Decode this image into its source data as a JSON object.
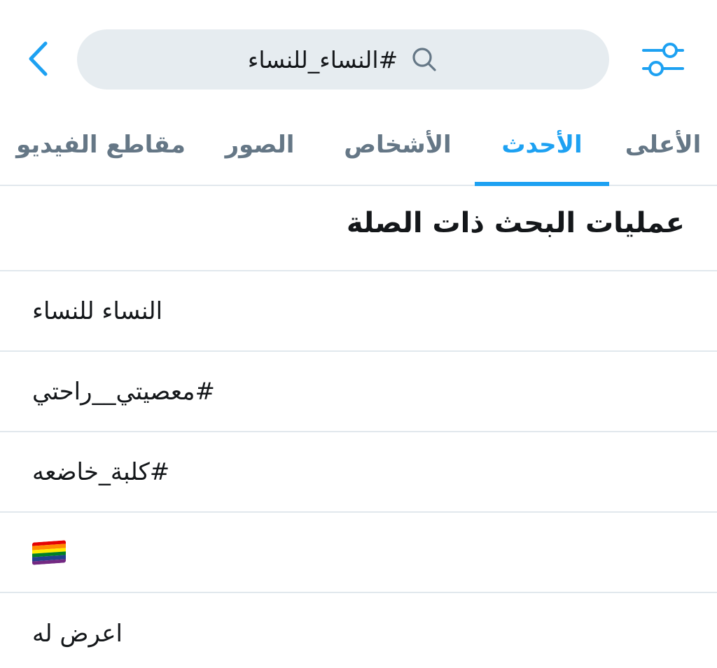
{
  "header": {
    "search_query": "#النساء_للنساء",
    "back_icon": "chevron-left-icon",
    "search_icon": "search-icon",
    "filter_icon": "sliders-icon"
  },
  "tabs": [
    {
      "label": "الأعلى",
      "active": false
    },
    {
      "label": "الأحدث",
      "active": true
    },
    {
      "label": "الأشخاص",
      "active": false
    },
    {
      "label": "الصور",
      "active": false
    },
    {
      "label": "مقاطع الفيديو",
      "active": false
    }
  ],
  "related": {
    "title": "عمليات البحث ذات الصلة",
    "items": [
      {
        "text": "النساء للنساء"
      },
      {
        "text": "#معصيتي__راحتي"
      },
      {
        "text": "#كلبة_خاضعه"
      },
      {
        "text": "🏳️‍🌈",
        "icon": "rainbow-flag-icon"
      },
      {
        "text": "اعرض له"
      }
    ]
  },
  "colors": {
    "accent": "#1da1f2",
    "text": "#14171a",
    "muted": "#657786",
    "search_bg": "#e6ecf0",
    "divider": "#e1e8ed",
    "rainbow": [
      "#e40303",
      "#ff8c00",
      "#ffed00",
      "#008026",
      "#24408e",
      "#732982"
    ]
  }
}
